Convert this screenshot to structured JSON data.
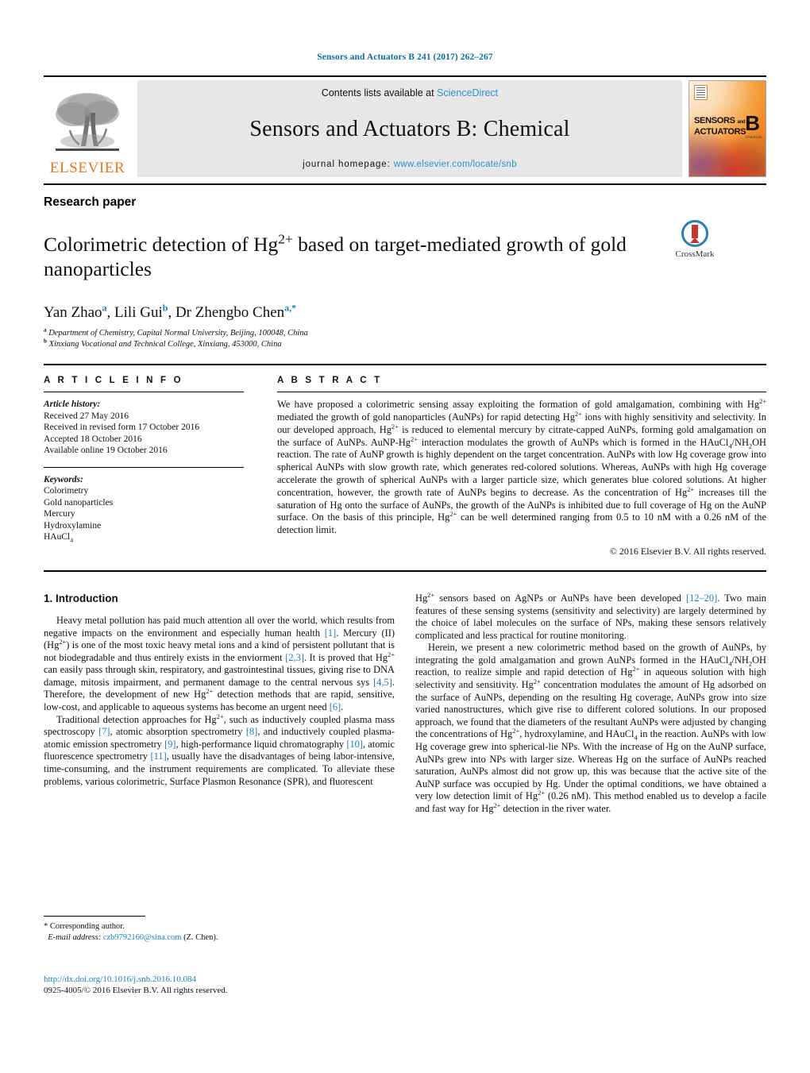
{
  "running_head": "Sensors and Actuators B 241 (2017) 262–267",
  "masthead": {
    "contents_prefix": "Contents lists available at ",
    "sciencedirect": "ScienceDirect",
    "journal_title": "Sensors and Actuators B: Chemical",
    "homepage_prefix": "journal homepage: ",
    "homepage_url": "www.elsevier.com/locate/snb",
    "publisher": "ELSEVIER",
    "cover": {
      "line1": "SENSORS",
      "and": "and",
      "line2": "ACTUATORS",
      "volume_letter": "B",
      "subtitle": "Chemical"
    }
  },
  "article": {
    "type": "Research paper",
    "title_part1": "Colorimetric detection of Hg",
    "title_sup": "2+",
    "title_part2": " based on target-mediated growth of gold nanoparticles",
    "crossmark_label": "CrossMark",
    "authors_plain": "Yan Zhao a, Lili Gui b, Dr Zhengbo Chen a,*",
    "authors": [
      {
        "name": "Yan Zhao",
        "marks": "a"
      },
      {
        "name": "Lili Gui",
        "marks": "b"
      },
      {
        "name": "Dr Zhengbo Chen",
        "marks": "a,*"
      }
    ],
    "affiliations": [
      {
        "mark": "a",
        "text": "Department of Chemistry, Capital Normal University, Beijing, 100048, China"
      },
      {
        "mark": "b",
        "text": "Xinxiang Vocational and Technical College, Xinxiang, 453000, China"
      }
    ]
  },
  "article_info": {
    "heading": "A R T I C L E   I N F O",
    "history_label": "Article history:",
    "history": [
      "Received 27 May 2016",
      "Received in revised form 17 October 2016",
      "Accepted 18 October 2016",
      "Available online 19 October 2016"
    ],
    "keywords_label": "Keywords:",
    "keywords": [
      "Colorimetry",
      "Gold nanoparticles",
      "Mercury",
      "Hydroxylamine",
      "HAuCl4"
    ]
  },
  "abstract": {
    "heading": "A B S T R A C T",
    "text": "We have proposed a colorimetric sensing assay exploiting the formation of gold amalgamation, combining with Hg2+ mediated the growth of gold nanoparticles (AuNPs) for rapid detecting Hg2+ ions with highly sensitivity and selectivity. In our developed approach, Hg2+ is reduced to elemental mercury by citrate-capped AuNPs, forming gold amalgamation on the surface of AuNPs. AuNP-Hg2+ interaction modulates the growth of AuNPs which is formed in the HAuCl4/NH2OH reaction. The rate of AuNP growth is highly dependent on the target concentration. AuNPs with low Hg coverage grow into spherical AuNPs with slow growth rate, which generates red-colored solutions. Whereas, AuNPs with high Hg coverage accelerate the growth of spherical AuNPs with a larger particle size, which generates blue colored solutions. At higher concentration, however, the growth rate of AuNPs begins to decrease. As the concentration of Hg2+ increases till the saturation of Hg onto the surface of AuNPs, the growth of the AuNPs is inhibited due to full coverage of Hg on the AuNP surface. On the basis of this principle, Hg2+ can be well determined ranging from 0.5 to 10 nM with a 0.26 nM of the detection limit.",
    "copyright": "© 2016 Elsevier B.V. All rights reserved."
  },
  "body": {
    "section_heading": "1. Introduction",
    "left_paragraph_1": "Heavy metal pollution has paid much attention all over the world, which results from negative impacts on the environment and especially human health [1]. Mercury (II) (Hg2+) is one of the most toxic heavy metal ions and a kind of persistent pollutant that is not biodegradable and thus entirely exists in the enviorment [2,3]. It is proved that Hg2+ can easily pass through skin, respiratory, and gastrointestinal tissues, giving rise to DNA damage, mitosis impairment, and permanent damage to the central nervous sys [4,5]. Therefore, the development of new Hg2+ detection methods that are rapid, sensitive, low-cost, and applicable to aqueous systems has become an urgent need [6].",
    "left_paragraph_2": "Traditional detection approaches for Hg2+, such as inductively coupled plasma mass spectroscopy [7], atomic absorption spectrometry [8], and inductively coupled plasma-atomic emission spectrometry [9], high-performance liquid chromatography [10], atomic fluorescence spectrometry [11], usually have the disadvantages of being labor-intensive, time-consuming, and the instrument requirements are complicated. To alleviate these problems, various colorimetric, Surface Plasmon Resonance (SPR), and fluorescent",
    "right_paragraph_1": "Hg2+ sensors based on AgNPs or AuNPs have been developed [12–20]. Two main features of these sensing systems (sensitivity and selectivity) are largely determined by the choice of label molecules on the surface of NPs, making these sensors relatively complicated and less practical for routine monitoring.",
    "right_paragraph_2": "Herein, we present a new colorimetric method based on the growth of AuNPs, by integrating the gold amalgamation and grown AuNPs formed in the HAuCl4/NH2OH reaction, to realize simple and rapid detection of Hg2+ in aqueous solution with high selectivity and sensitivity. Hg2+ concentration modulates the amount of Hg adsorbed on the surface of AuNPs, depending on the resulting Hg coverage, AuNPs grow into size varied nanostructures, which give rise to different colored solutions. In our proposed approach, we found that the diameters of the resultant AuNPs were adjusted by changing the concentrations of Hg2+, hydroxylamine, and HAuCl4 in the reaction. AuNPs with low Hg coverage grew into spherical-lie NPs. With the increase of Hg on the AuNP surface, AuNPs grew into NPs with larger size. Whereas Hg on the surface of AuNPs reached saturation, AuNPs almost did not grow up, this was because that the active site of the AuNP surface was occupied by Hg. Under the optimal conditions, we have obtained a very low detection limit of Hg2+ (0.26 nM). This method enabled us to develop a facile and fast way for Hg2+ detection in the river water."
  },
  "footnotes": {
    "corresponding_marker": "*",
    "corresponding_label": "Corresponding author.",
    "email_label": "E-mail address:",
    "email": "czb9792160@sina.com",
    "email_suffix": "(Z. Chen).",
    "doi": "http://dx.doi.org/10.1016/j.snb.2016.10.084",
    "issn_line": "0925-4005/© 2016 Elsevier B.V. All rights reserved."
  },
  "colors": {
    "link_blue": "#1a7fb5",
    "sciencedirect_blue": "#2a93c9",
    "elsevier_orange": "#E87722",
    "masthead_gray": "#e7e7e8"
  }
}
